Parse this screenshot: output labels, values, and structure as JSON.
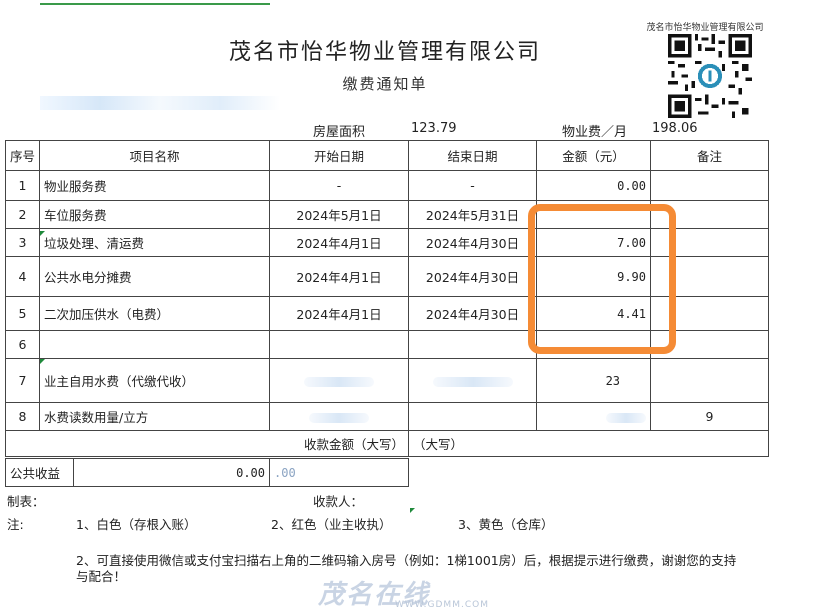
{
  "company_title": "茂名市怡华物业管理有限公司",
  "document_title": "缴费通知单",
  "qr_caption": "茂名市怡华物业管理有限公司",
  "info": {
    "area_label": "房屋面积",
    "area_value": "123.79",
    "fee_label": "物业费／月",
    "fee_value": "198.06"
  },
  "table": {
    "headers": [
      "序号",
      "项目名称",
      "开始日期",
      "结束日期",
      "金额（元）",
      "备注"
    ],
    "rows": [
      {
        "no": "1",
        "item": "物业服务费",
        "start": "-",
        "end": "-",
        "amount": "0.00",
        "note": ""
      },
      {
        "no": "2",
        "item": "车位服务费",
        "start": "2024年5月1日",
        "end": "2024年5月31日",
        "amount": "",
        "note": ""
      },
      {
        "no": "3",
        "item": "垃圾处理、清运费",
        "start": "2024年4月1日",
        "end": "2024年4月30日",
        "amount": "7.00",
        "note": ""
      },
      {
        "no": "4",
        "item": "公共水电分摊费",
        "start": "2024年4月1日",
        "end": "2024年4月30日",
        "amount": "9.90",
        "note": ""
      },
      {
        "no": "5",
        "item": "二次加压供水（电费）",
        "start": "2024年4月1日",
        "end": "2024年4月30日",
        "amount": "4.41",
        "note": ""
      },
      {
        "no": "6",
        "item": "",
        "start": "",
        "end": "",
        "amount": "",
        "note": ""
      },
      {
        "no": "7",
        "item": "业主自用水费（代缴代收）",
        "start": "",
        "end": "",
        "amount": "23",
        "note": ""
      },
      {
        "no": "8",
        "item": "水费读数用量/立方",
        "start": "",
        "end": "",
        "amount": "",
        "note": "9"
      }
    ],
    "total_label": "收款金额（大写）",
    "total_value": "（大写）",
    "public_income_label": "公共收益",
    "public_income_value": "0.00",
    "public_income_other": ".00"
  },
  "footer": {
    "maker_label": "制表：",
    "receiver_label": "收款人：",
    "note_label": "注:",
    "note1": "1、白色（存根入账）",
    "note2": "2、红色（业主收执）",
    "note3": "3、黄色（仓库）",
    "note4_line1": "2、可直接使用微信或支付宝扫描右上角的二维码输入房号（例如：1梯1001房）后，根据提示进行缴费，谢谢您的支持",
    "note4_line2": "与配合！"
  },
  "watermark": {
    "text": "茂名在线",
    "sub": "WWW.GDMM.COM"
  },
  "colors": {
    "highlight": "#f58b35",
    "grid": "#444444",
    "watermark": "#c9d4e4"
  }
}
